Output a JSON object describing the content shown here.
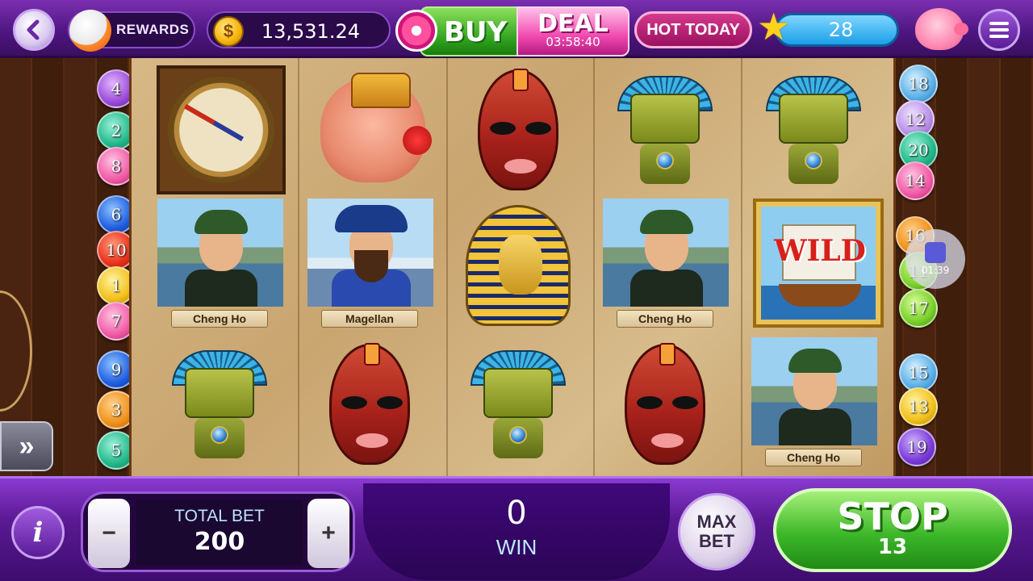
{
  "header": {
    "rewards_label": "REWARDS",
    "coin_symbol": "$",
    "balance": "13,531.24",
    "buy_label": "BUY",
    "deal_label": "DEAL",
    "deal_timer": "03:58:40",
    "hot_today_label": "HOT TODAY",
    "level": "28",
    "icons": [
      "back-arrow-icon",
      "rewards-mascot-icon",
      "coin-icon",
      "gift-icon",
      "star-icon",
      "piggy-bank-icon",
      "menu-icon"
    ]
  },
  "reels": {
    "grid": [
      [
        {
          "symbol": "compass",
          "label": ""
        },
        {
          "symbol": "explorer-cheng-ho",
          "label": "Cheng Ho"
        },
        {
          "symbol": "green-idol",
          "label": ""
        }
      ],
      [
        {
          "symbol": "ganesha",
          "label": ""
        },
        {
          "symbol": "explorer-magellan",
          "label": "Magellan"
        },
        {
          "symbol": "red-mask",
          "label": ""
        }
      ],
      [
        {
          "symbol": "red-mask",
          "label": ""
        },
        {
          "symbol": "pharaoh",
          "label": ""
        },
        {
          "symbol": "green-idol",
          "label": ""
        }
      ],
      [
        {
          "symbol": "green-idol",
          "label": ""
        },
        {
          "symbol": "explorer-cheng-ho",
          "label": "Cheng Ho"
        },
        {
          "symbol": "red-mask",
          "label": ""
        }
      ],
      [
        {
          "symbol": "green-idol",
          "label": ""
        },
        {
          "symbol": "wild-ship",
          "label": "WILD"
        },
        {
          "symbol": "explorer-cheng-ho",
          "label": "Cheng Ho"
        }
      ]
    ]
  },
  "paylines": {
    "left": [
      "4",
      "2",
      "8",
      "6",
      "10",
      "1",
      "7",
      "9",
      "3",
      "5"
    ],
    "right": [
      "18",
      "12",
      "20",
      "14",
      "16",
      "11",
      "17",
      "15",
      "13",
      "19"
    ],
    "left_colors": [
      "#9a4ad8",
      "#22b889",
      "#f05aa6",
      "#1f5ee0",
      "#e8301a",
      "#f2c01a",
      "#f05aa6",
      "#1f5ee0",
      "#f0901a",
      "#22b889"
    ],
    "right_colors": [
      "#5ab0e8",
      "#b890e8",
      "#22b889",
      "#f05aa6",
      "#f0901a",
      "#7ad02a",
      "#7ad02a",
      "#5ab0e8",
      "#f2c01a",
      "#7a3ad8"
    ]
  },
  "overlay": {
    "video_time": "01:39"
  },
  "footer": {
    "info_label": "i",
    "minus_label": "−",
    "plus_label": "+",
    "total_bet_label": "TOTAL BET",
    "total_bet_value": "200",
    "win_value": "0",
    "win_label": "WIN",
    "max_label": "MAX",
    "bet_label": "BET",
    "stop_label": "STOP",
    "stop_count": "13",
    "expand_label": "»"
  }
}
